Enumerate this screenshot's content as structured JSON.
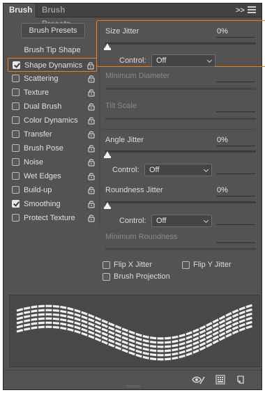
{
  "tabs": [
    {
      "label": "Brush",
      "active": true
    },
    {
      "label": "Brush Presets",
      "active": false
    }
  ],
  "header_icons": [
    "collapse-double-chevron-icon",
    "panel-menu-icon"
  ],
  "left": {
    "presets_button": "Brush Presets",
    "tip_shape_header": "Brush Tip Shape",
    "options": [
      {
        "label": "Shape Dynamics",
        "checked": true,
        "selected": true
      },
      {
        "label": "Scattering",
        "checked": false,
        "selected": false
      },
      {
        "label": "Texture",
        "checked": false,
        "selected": false
      },
      {
        "label": "Dual Brush",
        "checked": false,
        "selected": false
      },
      {
        "label": "Color Dynamics",
        "checked": false,
        "selected": false
      },
      {
        "label": "Transfer",
        "checked": false,
        "selected": false
      },
      {
        "label": "Brush Pose",
        "checked": false,
        "selected": false
      },
      {
        "label": "Noise",
        "checked": false,
        "selected": false
      },
      {
        "label": "Wet Edges",
        "checked": false,
        "selected": false
      },
      {
        "label": "Build-up",
        "checked": false,
        "selected": false
      },
      {
        "label": "Smoothing",
        "checked": true,
        "selected": false
      },
      {
        "label": "Protect Texture",
        "checked": false,
        "selected": false
      }
    ]
  },
  "right": {
    "size_jitter": {
      "label": "Size Jitter",
      "value": "0%",
      "level": 0
    },
    "size_control": {
      "label": "Control:",
      "value": "Off"
    },
    "minimum_diameter": {
      "label": "Minimum Diameter"
    },
    "tilt_scale": {
      "label": "Tilt Scale"
    },
    "angle_jitter": {
      "label": "Angle Jitter",
      "value": "0%",
      "level": 0
    },
    "angle_control": {
      "label": "Control:",
      "value": "Off"
    },
    "roundness_jitter": {
      "label": "Roundness Jitter",
      "value": "0%",
      "level": 0
    },
    "roundness_control": {
      "label": "Control:",
      "value": "Off"
    },
    "minimum_roundness": {
      "label": "Minimum Roundness"
    },
    "flip_x": {
      "label": "Flip X Jitter",
      "checked": false
    },
    "flip_y": {
      "label": "Flip Y Jitter",
      "checked": false
    },
    "brush_projection": {
      "label": "Brush Projection",
      "checked": false
    }
  },
  "footer_icons": [
    "eye-brush-icon",
    "grid-icon",
    "new-preset-icon"
  ],
  "colors": {
    "accent": "#f07d1a",
    "panel": "#535353",
    "tabbar": "#424242"
  }
}
